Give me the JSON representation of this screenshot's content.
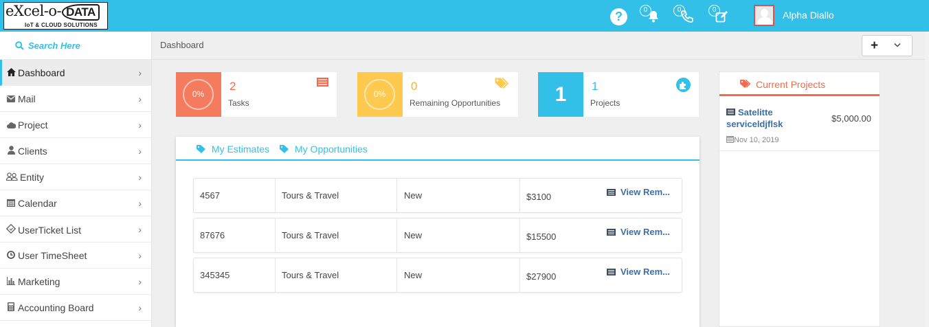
{
  "brand": {
    "logo_main": "eXcel-o-",
    "logo_box": "DATA",
    "logo_tagline": "IoT & CLOUD SOLUTIONS"
  },
  "topbar": {
    "help_icon": "question-circle-icon",
    "notifications": {
      "icon": "bell-icon",
      "count": "0"
    },
    "calls": {
      "icon": "phone-icon",
      "count": "0"
    },
    "tasks": {
      "icon": "edit-icon",
      "count": "0"
    },
    "user_name": "Alpha Diallo",
    "accent": "#33c0e8"
  },
  "sidebar": {
    "search_placeholder": "Search Here",
    "items": [
      {
        "label": "Dashboard",
        "icon": "home-icon"
      },
      {
        "label": "Mail",
        "icon": "envelope-icon"
      },
      {
        "label": "Project",
        "icon": "cloud-icon"
      },
      {
        "label": "Clients",
        "icon": "user-icon"
      },
      {
        "label": "Entity",
        "icon": "users-icon"
      },
      {
        "label": "Calendar",
        "icon": "calendar-icon"
      },
      {
        "label": "UserTicket List",
        "icon": "ticket-icon"
      },
      {
        "label": "User TimeSheet",
        "icon": "clock-icon"
      },
      {
        "label": "Marketing",
        "icon": "bar-chart-icon"
      },
      {
        "label": "Accounting Board",
        "icon": "calculator-icon"
      }
    ]
  },
  "breadcrumb": {
    "current": "Dashboard"
  },
  "stats": [
    {
      "percent": "0%",
      "value": "2",
      "label": "Tasks",
      "color": "#f47b5e",
      "num_color": "#f26b4b"
    },
    {
      "percent": "0%",
      "value": "0",
      "label": "Remaining Opportunities",
      "color": "#fdc94f",
      "num_color": "#f4b42a"
    },
    {
      "big": "1",
      "value": "1",
      "label": "Projects",
      "color": "#33c0e8",
      "num_color": "#33c0e8"
    }
  ],
  "estimates": {
    "tabs": [
      "My Estimates",
      "My Opportunities"
    ],
    "rows": [
      {
        "id": "4567",
        "category": "Tours & Travel",
        "status": "New",
        "amount": "$3100",
        "action": "View Rem..."
      },
      {
        "id": "87676",
        "category": "Tours & Travel",
        "status": "New",
        "amount": "$15500",
        "action": "View Rem..."
      },
      {
        "id": "345345",
        "category": "Tours & Travel",
        "status": "New",
        "amount": "$27900",
        "action": "View Rem..."
      }
    ]
  },
  "current_projects": {
    "title": "Current Projects",
    "items": [
      {
        "name": "Satelitte serviceldjflsk",
        "amount": "$5,000.00",
        "date": "Nov 10, 2019"
      }
    ]
  }
}
